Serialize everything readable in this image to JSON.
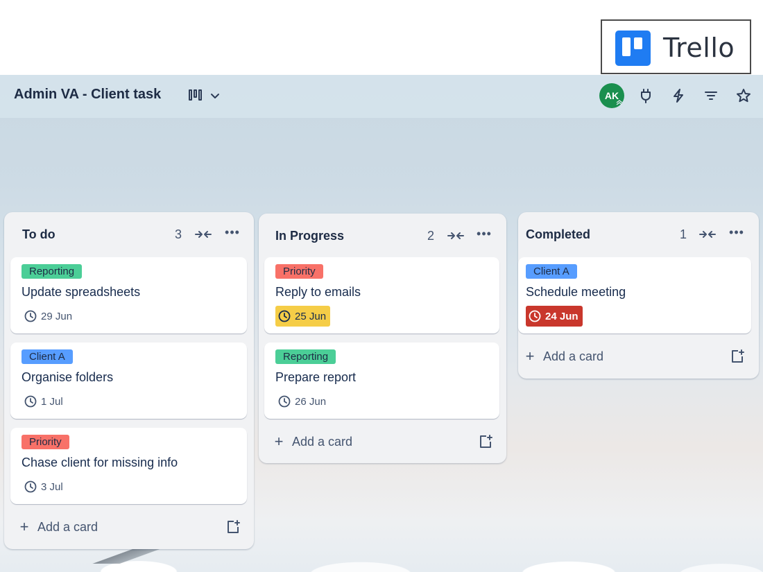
{
  "logo": {
    "text": "Trello",
    "brand_color": "#1f7cf2"
  },
  "header": {
    "board_title": "Admin VA - Client task",
    "view_icon": "board-view-icon",
    "avatar_initials": "AK",
    "avatar_color": "#1a8f4e",
    "icons": [
      "power-ups-icon",
      "automation-icon",
      "filter-icon",
      "star-icon"
    ]
  },
  "label_colors": {
    "Reporting": "#4bce97",
    "Client A": "#579dff",
    "Priority": "#f87168"
  },
  "due_colors": {
    "warn": "#f5cd47",
    "overdue": "#c9372c"
  },
  "lists": [
    {
      "title": "To do",
      "count": "3",
      "cards": [
        {
          "label": "Reporting",
          "title": "Update spreadsheets",
          "due": "29 Jun"
        },
        {
          "label": "Client A",
          "title": "Organise folders",
          "due": "1 Jul"
        },
        {
          "label": "Priority",
          "title": "Chase client for missing info",
          "due": "3 Jul"
        }
      ],
      "add_card": "Add a card"
    },
    {
      "title": "In Progress",
      "count": "2",
      "cards": [
        {
          "label": "Priority",
          "title": "Reply to emails",
          "due": "25 Jun",
          "due_status": "warn"
        },
        {
          "label": "Reporting",
          "title": "Prepare report",
          "due": "26 Jun"
        }
      ],
      "add_card": "Add a card"
    },
    {
      "title": "Completed",
      "count": "1",
      "cards": [
        {
          "label": "Client A",
          "title": "Schedule meeting",
          "due": "24 Jun",
          "due_status": "overdue"
        }
      ],
      "add_card": "Add a card"
    }
  ]
}
